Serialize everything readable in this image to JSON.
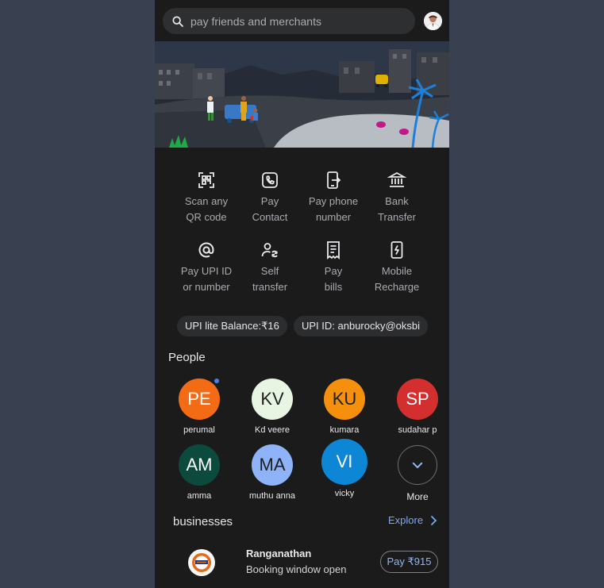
{
  "search": {
    "placeholder": "pay friends and merchants"
  },
  "actions": [
    {
      "label": "Scan any\nQR code",
      "icon": "qr-scan-icon"
    },
    {
      "label": "Pay\nContact",
      "icon": "contact-pay-icon"
    },
    {
      "label": "Pay phone\nnumber",
      "icon": "phone-pay-icon"
    },
    {
      "label": "Bank\nTransfer",
      "icon": "bank-icon"
    },
    {
      "label": "Pay UPI ID\nor number",
      "icon": "at-icon"
    },
    {
      "label": "Self\ntransfer",
      "icon": "self-transfer-icon"
    },
    {
      "label": "Pay\nbills",
      "icon": "bill-icon"
    },
    {
      "label": "Mobile\nRecharge",
      "icon": "mobile-recharge-icon"
    }
  ],
  "chips": {
    "upi_lite": "UPI lite Balance:₹16",
    "upi_id": "UPI ID: anburocky@oksbi"
  },
  "people": {
    "title": "People",
    "contacts": [
      {
        "initials": "PE",
        "name": "perumal",
        "color": "#f46b16",
        "text_color": "#ffffff",
        "new": true
      },
      {
        "initials": "KV",
        "name": "Kd veere",
        "color": "#e8f5e3",
        "text_color": "#1e1e1e"
      },
      {
        "initials": "KU",
        "name": "kumara",
        "color": "#f5900c",
        "text_color": "#1e1e1e"
      },
      {
        "initials": "SP",
        "name": "sudahar p",
        "color": "#d32f2f",
        "text_color": "#ffffff"
      },
      {
        "initials": "AM",
        "name": "amma",
        "color": "#0c4a3e",
        "text_color": "#ffffff"
      },
      {
        "initials": "MA",
        "name": "muthu anna",
        "color": "#8fb3f9",
        "text_color": "#1e1e1e"
      },
      {
        "initials": "VI",
        "name": "vicky",
        "color": "#0d86d6",
        "text_color": "#ffffff"
      }
    ],
    "more_label": "More"
  },
  "businesses": {
    "title": "businesses",
    "explore_label": "Explore",
    "item": {
      "name": "Ranganathan",
      "subtitle": "Booking window open",
      "pay_label": "Pay ₹915"
    }
  },
  "colors": {
    "background": "#394150",
    "panel": "#1b1b1c",
    "accent": "#78a9f7"
  }
}
